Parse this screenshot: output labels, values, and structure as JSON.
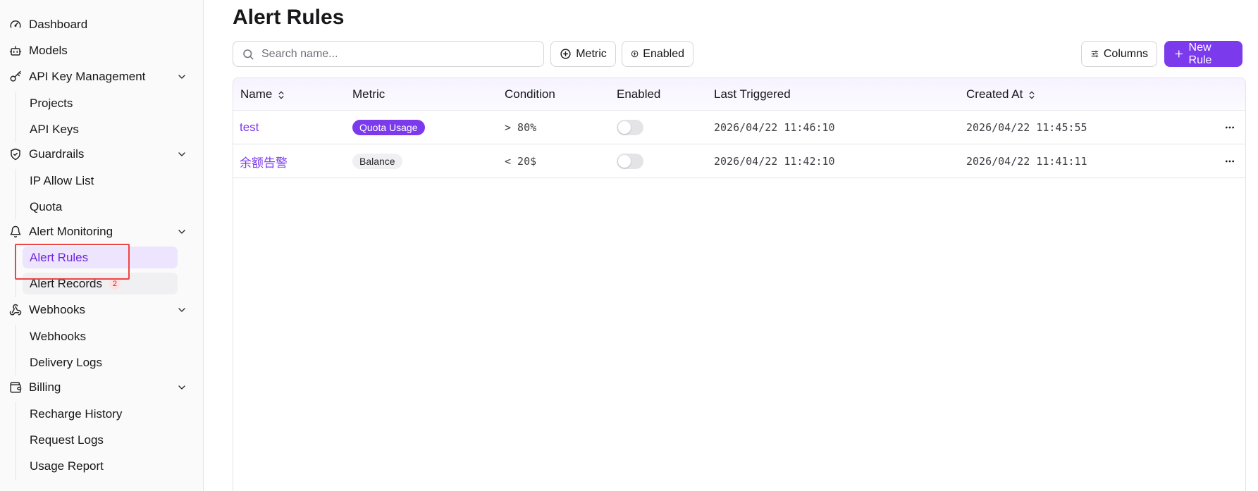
{
  "sidebar": {
    "items": [
      {
        "label": "Dashboard",
        "icon": "gauge-icon"
      },
      {
        "label": "Models",
        "icon": "bot-icon"
      },
      {
        "label": "API Key Management",
        "icon": "key-icon",
        "children": [
          {
            "label": "Projects"
          },
          {
            "label": "API Keys"
          }
        ]
      },
      {
        "label": "Guardrails",
        "icon": "shield-icon",
        "children": [
          {
            "label": "IP Allow List"
          },
          {
            "label": "Quota"
          }
        ]
      },
      {
        "label": "Alert Monitoring",
        "icon": "bell-icon",
        "children": [
          {
            "label": "Alert Rules",
            "active": true
          },
          {
            "label": "Alert Records",
            "badge": "2"
          }
        ]
      },
      {
        "label": "Webhooks",
        "icon": "webhook-icon",
        "children": [
          {
            "label": "Webhooks"
          },
          {
            "label": "Delivery Logs"
          }
        ]
      },
      {
        "label": "Billing",
        "icon": "wallet-icon",
        "children": [
          {
            "label": "Recharge History"
          },
          {
            "label": "Request Logs"
          },
          {
            "label": "Usage Report"
          }
        ]
      }
    ]
  },
  "main": {
    "title": "Alert Rules",
    "search": {
      "placeholder": "Search name..."
    },
    "filters": {
      "metric_label": "Metric",
      "enabled_label": "Enabled"
    },
    "toolbar": {
      "columns_label": "Columns",
      "new_rule_label": "New Rule"
    },
    "table": {
      "columns": [
        "Name",
        "Metric",
        "Condition",
        "Enabled",
        "Last Triggered",
        "Created At"
      ],
      "rows": [
        {
          "name": "test",
          "metric": "Quota Usage",
          "metric_style": "primary",
          "condition": "> 80%",
          "enabled": false,
          "last_triggered": "2026/04/22 11:46:10",
          "created_at": "2026/04/22 11:45:55"
        },
        {
          "name": "余额告警",
          "metric": "Balance",
          "metric_style": "neutral",
          "condition": "< 20$",
          "enabled": false,
          "last_triggered": "2026/04/22 11:42:10",
          "created_at": "2026/04/22 11:41:11"
        }
      ]
    }
  },
  "colors": {
    "accent": "#7c3aed",
    "active_bg": "#ede4fe",
    "highlight": "#ef4444",
    "badge_red": "#dc2626"
  }
}
